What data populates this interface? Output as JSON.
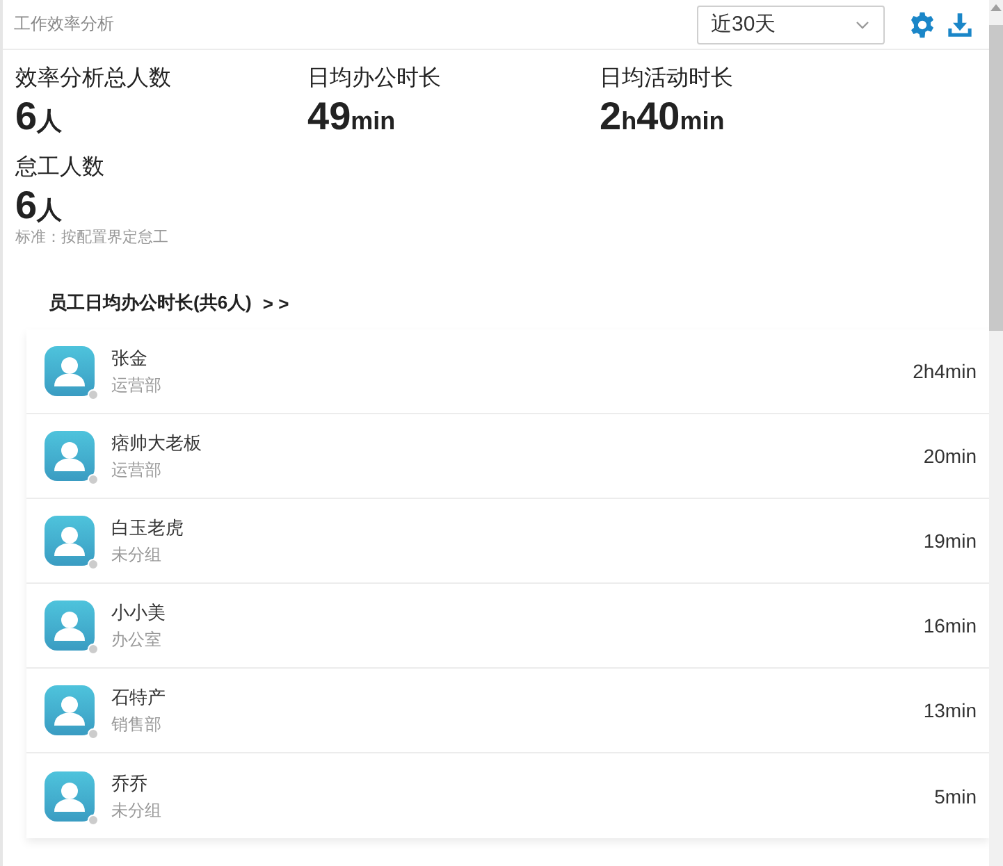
{
  "header": {
    "title": "工作效率分析",
    "period": {
      "value": "近30天"
    }
  },
  "stats": [
    {
      "label": "效率分析总人数",
      "value": "6人"
    },
    {
      "label": "日均办公时长",
      "value": "49min"
    },
    {
      "label": "日均活动时长",
      "value": "2h40min"
    },
    {
      "label": "怠工人数",
      "value": "6人",
      "note": "标准：按配置界定怠工"
    }
  ],
  "ranking": {
    "title": "员工日均办公时长(共6人)",
    "more": "> >",
    "employees": [
      {
        "name": "张金",
        "department": "运营部",
        "online": false,
        "duration": "2h4min"
      },
      {
        "name": "痞帅大老板",
        "department": "运营部",
        "online": false,
        "duration": "20min"
      },
      {
        "name": "白玉老虎",
        "department": "未分组",
        "online": false,
        "duration": "19min"
      },
      {
        "name": "小小美",
        "department": "办公室",
        "online": false,
        "duration": "16min"
      },
      {
        "name": "石特产",
        "department": "销售部",
        "online": false,
        "duration": "13min"
      },
      {
        "name": "乔乔",
        "department": "未分组",
        "online": false,
        "duration": "5min"
      }
    ]
  }
}
